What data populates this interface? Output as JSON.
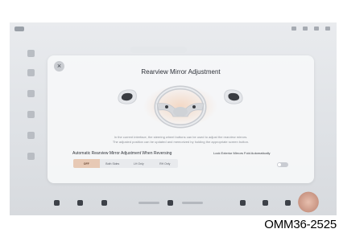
{
  "modal": {
    "title": "Rearview Mirror Adjustment",
    "close_symbol": "×",
    "description_lines": [
      "In the current interface, the steering wheel buttons can be used to adjust the rearview mirrors.",
      "The adjusted position can be updated and memorized by holding the appropriate screen button."
    ],
    "auto_adjust": {
      "label": "Automatic Rearview Mirror Adjustment When Reversing",
      "options": [
        "OFF",
        "Both Sides",
        "LH Only",
        "RH Only"
      ],
      "selected": "OFF"
    },
    "fold": {
      "label": "Lock Exterior Mirrors Fold Automatically",
      "enabled": false
    }
  },
  "figure_label": "OMM36-2525",
  "colors": {
    "selected_option": "#e7c9b5",
    "modal_bg": "#f6f7f9",
    "screen_bg": "#e2e5e8",
    "toggle_off": "#c9ccd2"
  },
  "icons": {
    "close": "close-icon",
    "left_mirror": "left-mirror-icon",
    "right_mirror": "right-mirror-icon",
    "steering_wheel": "steering-wheel-icon"
  }
}
